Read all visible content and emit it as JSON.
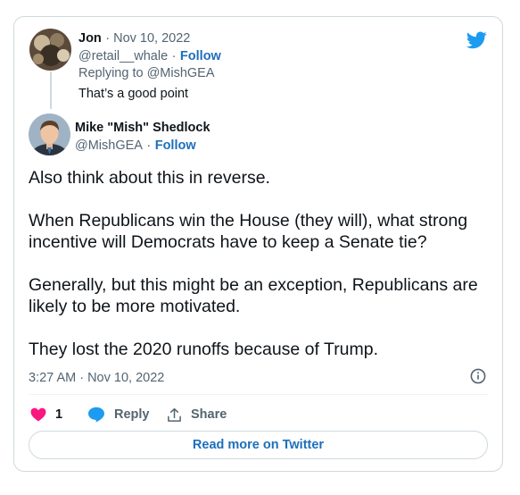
{
  "reply_tweet": {
    "author_name": "Jon",
    "date": "· Nov 10, 2022",
    "handle": "@retail__whale",
    "separator": "·",
    "follow_label": "Follow",
    "replying_to": "Replying to @MishGEA",
    "text": "That’s a good point"
  },
  "main_tweet": {
    "author_name": "Mike \"Mish\" Shedlock",
    "handle": "@MishGEA",
    "separator": "·",
    "follow_label": "Follow",
    "paragraphs": [
      "Also think about this in reverse.",
      "When Republicans win the House (they will), what strong incentive will Democrats have to keep a  Senate tie?",
      "Generally, but this might be an exception, Republicans are likely to be more motivated.",
      "They lost the 2020 runoffs because of Trump."
    ],
    "timestamp": "3:27 AM · Nov 10, 2022"
  },
  "actions": {
    "like_count": "1",
    "reply_label": "Reply",
    "share_label": "Share"
  },
  "read_more_label": "Read more on Twitter",
  "colors": {
    "twitter_blue": "#1d9bf0",
    "link_blue": "#1d6fba",
    "like_red": "#f91880",
    "muted": "#536471",
    "border": "#cfd9de"
  },
  "icons": {
    "brand": "twitter-bird-icon",
    "like": "heart-icon",
    "reply": "speech-bubble-icon",
    "share": "share-upload-icon",
    "info": "info-icon"
  }
}
